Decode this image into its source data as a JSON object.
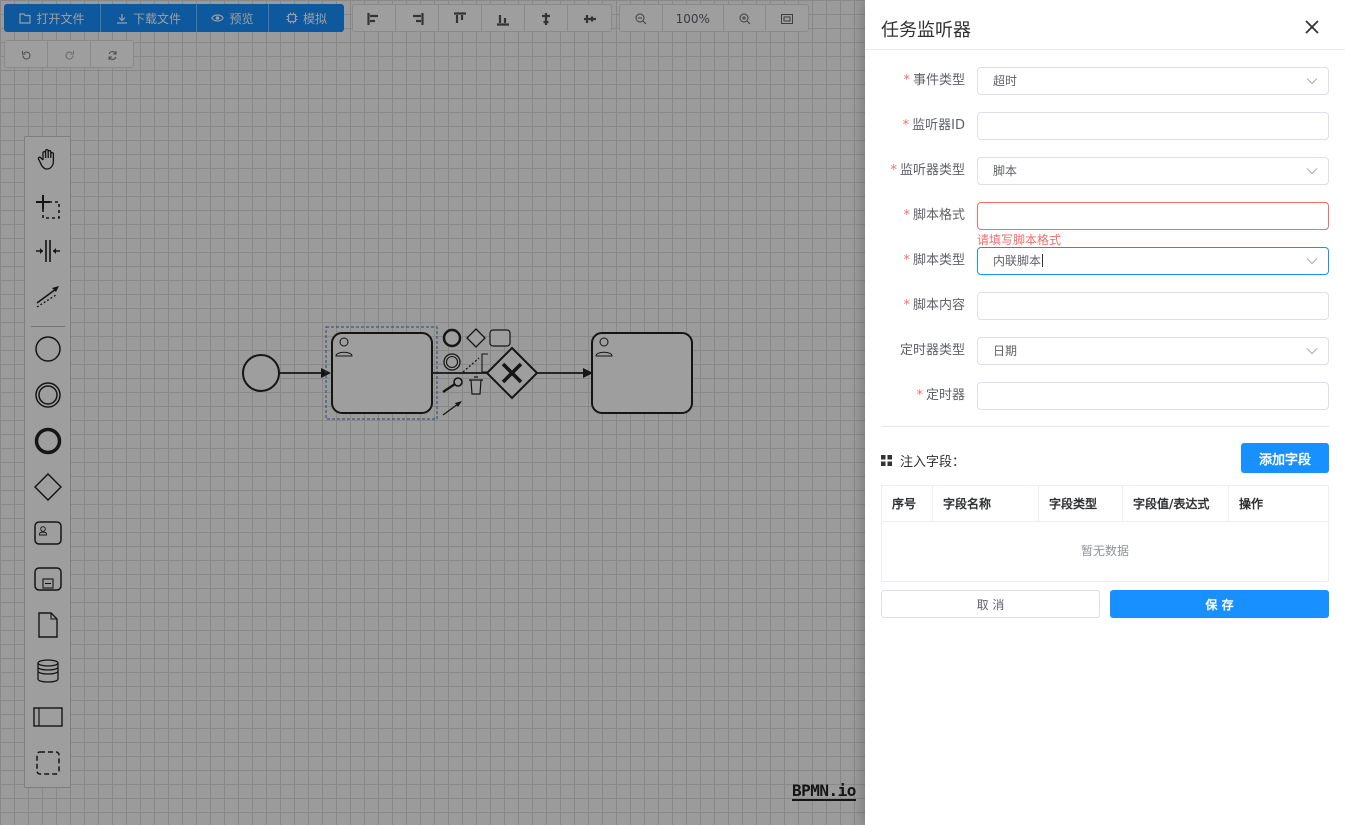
{
  "toolbar": {
    "open_file": "打开文件",
    "download_file": "下载文件",
    "preview": "预览",
    "simulate": "模拟",
    "zoom": "100%"
  },
  "watermark": "BPMN.io",
  "drawer": {
    "title": "任务监听器",
    "fields": [
      {
        "label": "事件类型",
        "required": true,
        "value": "超时",
        "type": "select"
      },
      {
        "label": "监听器ID",
        "required": true,
        "value": "",
        "type": "input"
      },
      {
        "label": "监听器类型",
        "required": true,
        "value": "脚本",
        "type": "select"
      },
      {
        "label": "脚本格式",
        "required": true,
        "value": "",
        "type": "input",
        "error": "请填写脚本格式"
      },
      {
        "label": "脚本类型",
        "required": true,
        "value": "内联脚本",
        "type": "select"
      },
      {
        "label": "脚本内容",
        "required": true,
        "value": "",
        "type": "input"
      },
      {
        "label": "定时器类型",
        "required": false,
        "value": "日期",
        "type": "select"
      },
      {
        "label": "定时器",
        "required": true,
        "value": "",
        "type": "input"
      }
    ],
    "inject_title": "注入字段：",
    "add_field": "添加字段",
    "table_headers": [
      "序号",
      "字段名称",
      "字段类型",
      "字段值/表达式",
      "操作"
    ],
    "empty_text": "暂无数据",
    "cancel": "取 消",
    "save": "保 存"
  },
  "colors": {
    "primary": "#1890ff",
    "danger": "#f56c6c"
  }
}
